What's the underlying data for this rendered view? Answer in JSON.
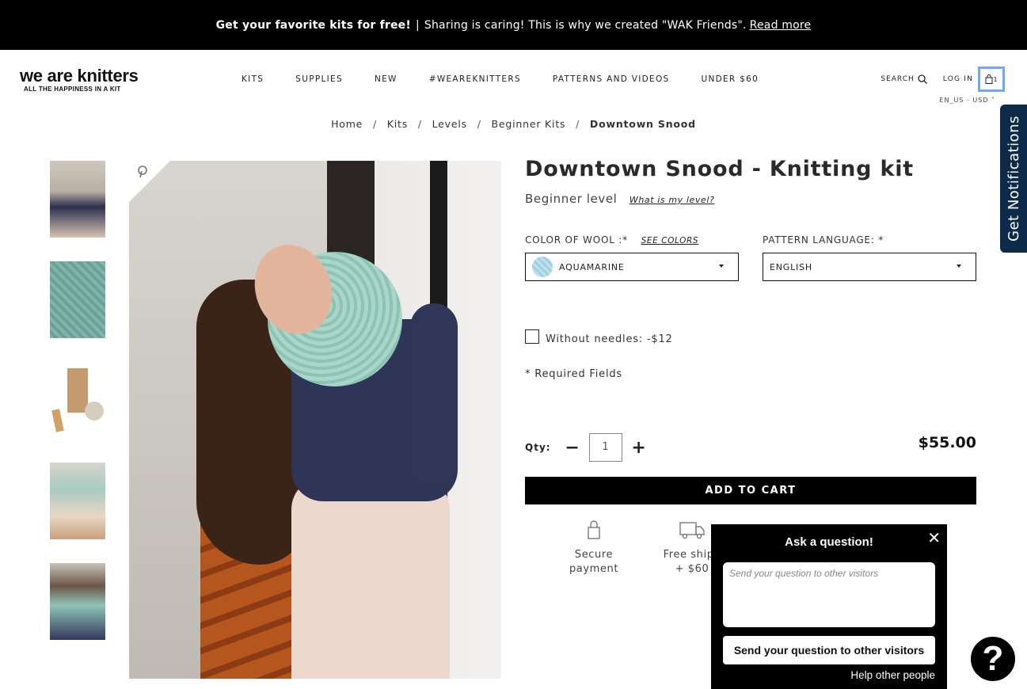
{
  "announcement": {
    "bold": "Get your favorite kits for free!",
    "separator": "|",
    "text": "Sharing is caring! This is why we created \"WAK Friends\".",
    "link": "Read more"
  },
  "logo": {
    "name": "we are knitters",
    "tagline": "ALL THE HAPPINESS IN A KIT"
  },
  "nav": [
    "KITS",
    "SUPPLIES",
    "NEW",
    "#WEAREKNITTERS",
    "PATTERNS AND VIDEOS",
    "UNDER $60"
  ],
  "header": {
    "search": "SEARCH",
    "login": "LOG IN",
    "cart_count": "1",
    "locale": "EN_US - USD"
  },
  "breadcrumb": [
    "Home",
    "Kits",
    "Levels",
    "Beginner Kits"
  ],
  "breadcrumb_current": "Downtown Snood",
  "breadcrumb_sep": "/",
  "notifications_tab": "Get Notifications",
  "product": {
    "title": "Downtown Snood - Knitting kit",
    "level": "Beginner level",
    "level_link": "What is my level?",
    "color_label": "COLOR OF WOOL :*",
    "see_colors": "SEE COLORS",
    "color_value": "AQUAMARINE",
    "pattern_label": "PATTERN LANGUAGE: *",
    "pattern_value": "ENGLISH",
    "needles_label": "Without needles: -$12",
    "required": "* Required Fields",
    "qty_label": "Qty:",
    "qty_value": "1",
    "price": "$55.00",
    "add_to_cart": "ADD TO CART"
  },
  "features": [
    {
      "icon": "lock-icon",
      "line1": "Secure",
      "line2": "payment"
    },
    {
      "icon": "truck-icon",
      "line1": "Free shipp",
      "line2": "+ $60"
    }
  ],
  "ask": {
    "title": "Ask a question!",
    "placeholder": "Send your question to other visitors",
    "send": "Send your question to other visitors",
    "help": "Help other people"
  },
  "help_bubble": "?"
}
